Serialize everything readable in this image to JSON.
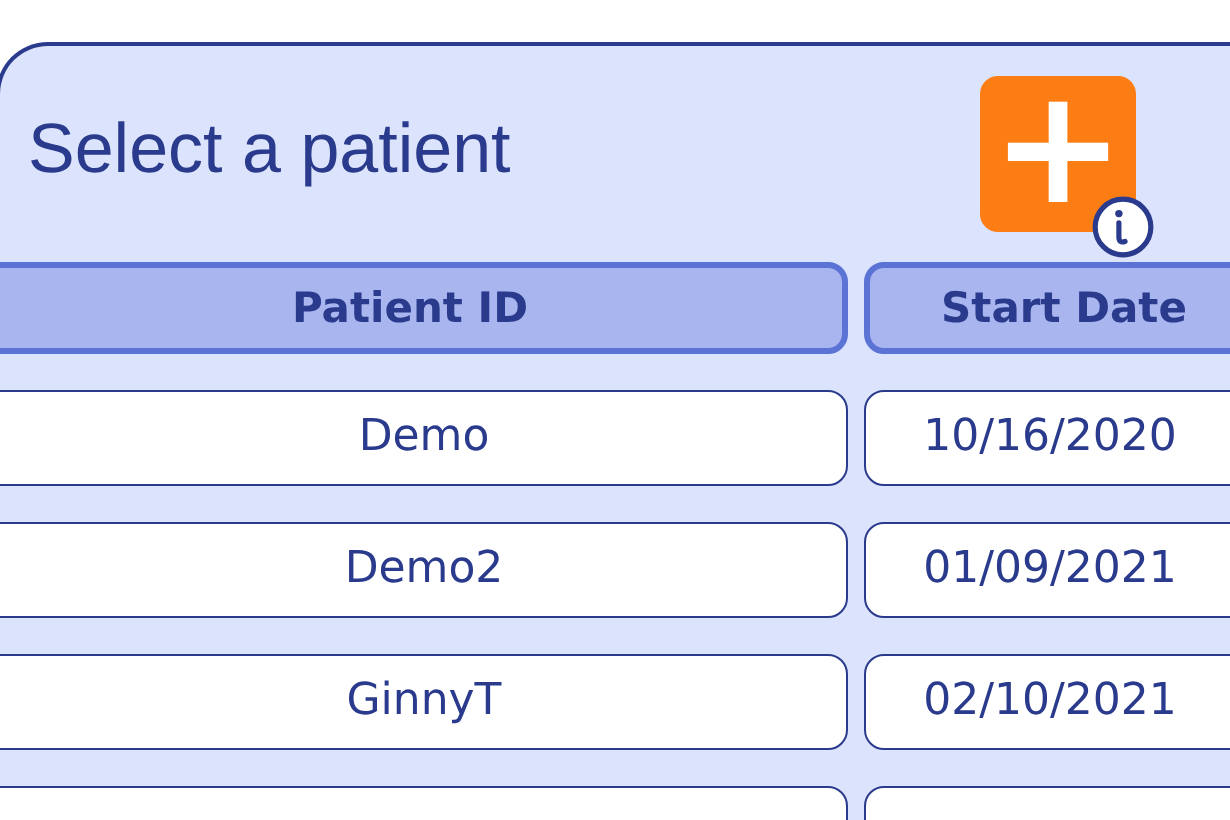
{
  "title": "Select a patient",
  "add_button": {
    "label": "+"
  },
  "table": {
    "columns": [
      "Patient ID",
      "Start Date"
    ],
    "rows": [
      {
        "patient_id": "Demo",
        "start_date": "10/16/2020"
      },
      {
        "patient_id": "Demo2",
        "start_date": "01/09/2021"
      },
      {
        "patient_id": "GinnyT",
        "start_date": "02/10/2021"
      }
    ]
  }
}
